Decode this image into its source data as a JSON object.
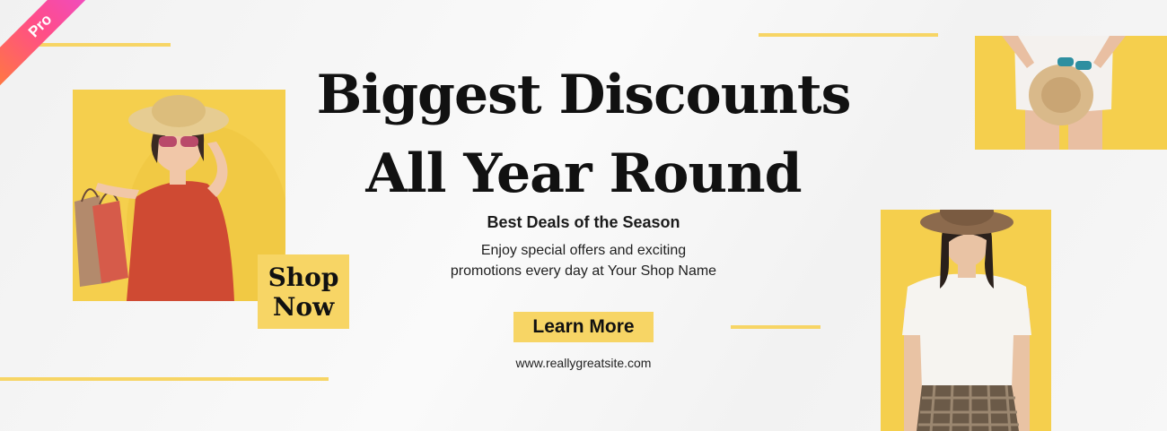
{
  "badge": {
    "label": "Pro"
  },
  "headline": {
    "line1": "Biggest Discounts",
    "line2": "All Year Round"
  },
  "subtitle": "Best Deals of the Season",
  "description": {
    "line1": "Enjoy special offers and exciting",
    "line2": "promotions every day at Your Shop Name"
  },
  "cta": {
    "learn_more": "Learn More",
    "shop_now_line1": "Shop",
    "shop_now_line2": "Now"
  },
  "website": "www.reallygreatsite.com",
  "colors": {
    "accent": "#f7d565",
    "photo_bg": "#f5cf4d",
    "text": "#111111",
    "badge_gradient": [
      "#ff7a3d",
      "#e94bd6"
    ]
  },
  "images": [
    {
      "name": "woman-with-shopping-bags-photo"
    },
    {
      "name": "hat-held-at-waist-photo"
    },
    {
      "name": "woman-in-hat-standing-photo"
    }
  ]
}
